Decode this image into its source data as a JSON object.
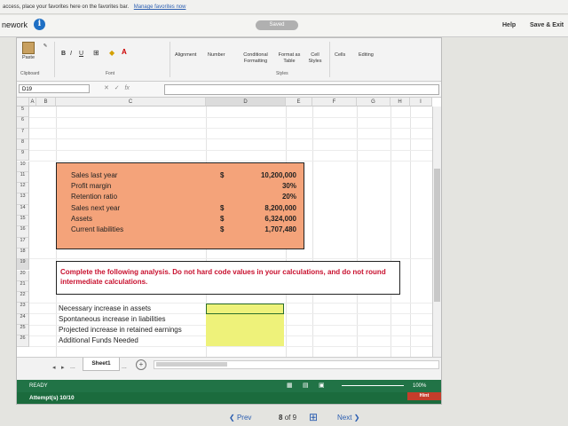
{
  "favorites_bar": {
    "text": "access, place your favorites here on the favorites bar.",
    "link": "Manage favorites now"
  },
  "topbar": {
    "brand": "nework",
    "saved": "Saved",
    "help": "Help",
    "save_exit": "Save & Exit"
  },
  "ribbon": {
    "paste": "Paste",
    "bold": "B",
    "italic": "I",
    "underline": "U",
    "alignment": "Alignment",
    "number": "Number",
    "conditional_formatting": "Conditional Formatting",
    "format_as_table": "Format as Table",
    "cell_styles": "Cell Styles",
    "cells": "Cells",
    "editing": "Editing",
    "groups": {
      "clipboard": "Clipboard",
      "font": "Font",
      "styles": "Styles"
    }
  },
  "formula_bar": {
    "name_box": "D19",
    "fx": "fx",
    "value": ""
  },
  "columns": [
    "A",
    "B",
    "C",
    "D",
    "E",
    "F",
    "G",
    "H",
    "I"
  ],
  "rows": [
    "5",
    "6",
    "7",
    "8",
    "9",
    "10",
    "11",
    "12",
    "13",
    "14",
    "15",
    "16",
    "17",
    "18",
    "19",
    "20",
    "21",
    "22",
    "23",
    "24",
    "25",
    "26"
  ],
  "inputs": [
    {
      "label": "Sales last year",
      "dollar": "$",
      "value": "10,200,000"
    },
    {
      "label": "Profit margin",
      "dollar": "",
      "value": "30%"
    },
    {
      "label": "Retention ratio",
      "dollar": "",
      "value": "20%"
    },
    {
      "label": "Sales next year",
      "dollar": "$",
      "value": "8,200,000"
    },
    {
      "label": "Assets",
      "dollar": "$",
      "value": "6,324,000"
    },
    {
      "label": "Current liabilities",
      "dollar": "$",
      "value": "1,707,480"
    }
  ],
  "instruction": "Complete the following analysis. Do not hard code values in your calculations, and do not round intermediate calculations.",
  "analysis": [
    {
      "label": "Necessary increase in assets"
    },
    {
      "label": "Spontaneous increase in liabilities"
    },
    {
      "label": "Projected increase in retained earnings"
    },
    {
      "label": "Additional Funds Needed"
    }
  ],
  "sheet_tabs": {
    "ellipsis_left": "...",
    "active": "Sheet1",
    "ellipsis_right": "...",
    "add": "+"
  },
  "status_bar": {
    "ready": "READY",
    "zoom": "100%"
  },
  "attempts": "Attempt(s)  10/10",
  "hint": "Hint",
  "pager": {
    "prev": "Prev",
    "current": "8",
    "of": "of",
    "total": "9",
    "next": "Next"
  },
  "colors": {
    "accent": "#217346",
    "input_box": "#f4a37a",
    "answer_cell": "#eef27a",
    "warning_text": "#c8102e"
  }
}
